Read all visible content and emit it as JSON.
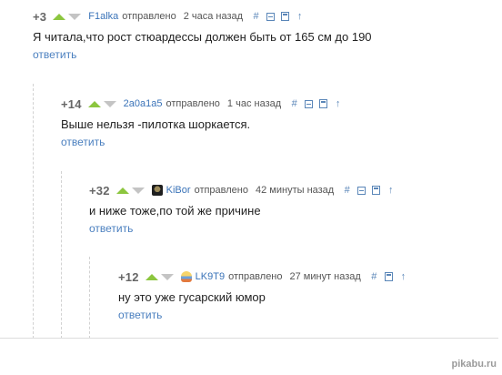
{
  "comments": [
    {
      "rating": "+3",
      "author": "F1alka",
      "sent": "отправлено",
      "time": "2 часа назад",
      "tools": {
        "link": "#",
        "up": "↑"
      },
      "text": "Я читала,что рост стюардессы должен быть от 165 см до 190",
      "reply": "ответить"
    },
    {
      "rating": "+14",
      "author": "2a0a1a5",
      "sent": "отправлено",
      "time": "1 час назад",
      "tools": {
        "link": "#",
        "up": "↑"
      },
      "text": "Выше нельзя -пилотка шоркается.",
      "reply": "ответить"
    },
    {
      "rating": "+32",
      "author": "KiBor",
      "sent": "отправлено",
      "time": "42 минуты назад",
      "tools": {
        "link": "#",
        "up": "↑"
      },
      "text": "и ниже тоже,по той же причине",
      "reply": "ответить"
    },
    {
      "rating": "+12",
      "author": "LK9T9",
      "sent": "отправлено",
      "time": "27 минут назад",
      "tools": {
        "link": "#",
        "up": "↑"
      },
      "text": "ну это уже гусарский юмор",
      "reply": "ответить"
    }
  ],
  "watermark": "pikabu.ru",
  "colors": {
    "upvote": "#8cc63f",
    "downvote": "#c4c4c4",
    "link": "#4a7fbf",
    "author": "#3a73b8"
  }
}
